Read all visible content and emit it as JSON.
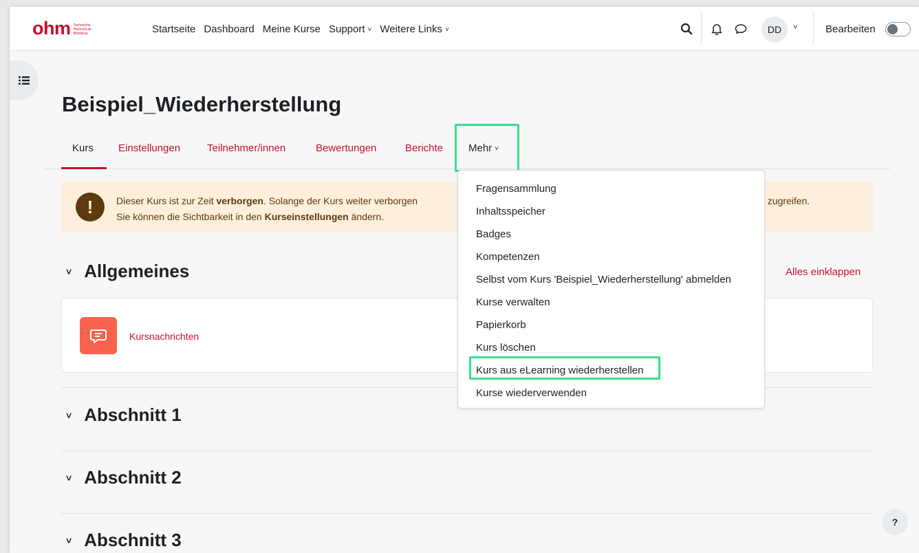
{
  "logo": {
    "text": "ohm",
    "subtitle": "Technische Hochschule Nürnberg"
  },
  "primary_nav": [
    {
      "label": "Startseite",
      "dropdown": false
    },
    {
      "label": "Dashboard",
      "dropdown": false
    },
    {
      "label": "Meine Kurse",
      "dropdown": false
    },
    {
      "label": "Support",
      "dropdown": true
    },
    {
      "label": "Weitere Links",
      "dropdown": true
    }
  ],
  "user": {
    "initials": "DD",
    "edit_mode_label": "Bearbeiten",
    "edit_mode_on": false
  },
  "icons": {
    "search": "search-icon",
    "notifications": "bell-icon",
    "messages": "chat-icon",
    "drawer": "course-index-icon",
    "help": "help-icon"
  },
  "course": {
    "title": "Beispiel_Wiederherstellung"
  },
  "secondary_nav": {
    "tabs": [
      "Kurs",
      "Einstellungen",
      "Teilnehmer/innen",
      "Bewertungen",
      "Berichte"
    ],
    "more_label": "Mehr"
  },
  "alert": {
    "line1_before": "Dieser Kurs ist zur Zeit ",
    "line1_bold": "verborgen",
    "line1_after": ". Solange der Kurs weiter verborgen",
    "line1_tail": "f zugreifen.",
    "line2_before": "Sie können die Sichtbarkeit in den ",
    "line2_bold": "Kurseinstellungen",
    "line2_after": " ändern."
  },
  "collapse_all_label": "Alles einklappen",
  "sections": [
    {
      "title": "Allgemeines"
    },
    {
      "title": "Abschnitt 1"
    },
    {
      "title": "Abschnitt 2"
    },
    {
      "title": "Abschnitt 3"
    }
  ],
  "activity": {
    "name": "Kursnachrichten"
  },
  "more_menu": [
    "Fragensammlung",
    "Inhaltsspeicher",
    "Badges",
    "Kompetenzen",
    "Selbst vom Kurs 'Beispiel_Wiederherstellung' abmelden",
    "Kurse verwalten",
    "Papierkorb",
    "Kurs löschen",
    "Kurs aus eLearning wiederherstellen",
    "Kurse wiederverwenden"
  ],
  "help_label": "?",
  "colors": {
    "brand": "#c8102e",
    "highlight": "#37e08f",
    "alert_bg": "#fcefdc",
    "activity_icon": "#f7634d"
  }
}
